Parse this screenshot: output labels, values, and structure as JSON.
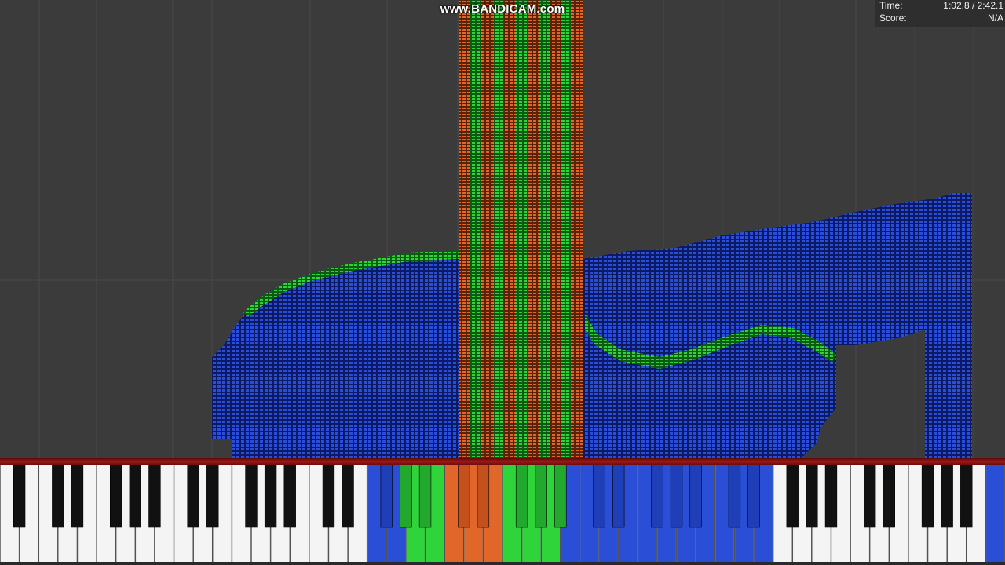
{
  "watermark": {
    "text": "www.BANDICAM.com"
  },
  "hud": {
    "time_label": "Time:",
    "time_value": "1:02.8 / 2:42.1",
    "score_label": "Score:",
    "score_value": "N/A"
  },
  "playback": {
    "elapsed": "1:02.8",
    "total": "2:42.1"
  },
  "colors": {
    "background": "#3b3b3b",
    "grid_line": "#4a4a4a",
    "note_blue": "#2a4fd6",
    "note_blue_edge": "#0c1a66",
    "note_green": "#2ed43a",
    "note_orange": "#e0662a",
    "keyboard_bar": "#a21818",
    "white_key": "#f4f4f4",
    "black_key": "#111111"
  },
  "keyboard": {
    "pressed_blue_range": [
      "key-19",
      "key-39"
    ],
    "pressed_green_keys": [
      "key-21",
      "key-22",
      "key-26",
      "key-27",
      "key-28"
    ],
    "pressed_orange_keys": [
      "key-23",
      "key-24",
      "key-25"
    ],
    "pressed_right_blue": [
      "key-51",
      "key-52"
    ]
  }
}
